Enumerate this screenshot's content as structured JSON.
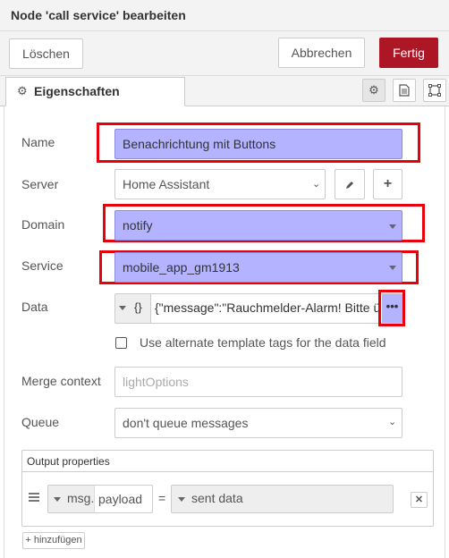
{
  "header": {
    "title": "Node 'call service' bearbeiten"
  },
  "toolbar": {
    "delete_label": "Löschen",
    "cancel_label": "Abbrechen",
    "done_label": "Fertig"
  },
  "tabs": {
    "properties_label": "Eigenschaften"
  },
  "form": {
    "name_label": "Name",
    "name_value": "Benachrichtung mit Buttons",
    "server_label": "Server",
    "server_value": "Home Assistant",
    "domain_label": "Domain",
    "domain_value": "notify",
    "service_label": "Service",
    "service_value": "mobile_app_gm1913",
    "data_label": "Data",
    "data_type": "{}",
    "data_value": "{\"message\":\"Rauchmelder-Alarm! Bitte üb",
    "alt_tags_label": "Use alternate template tags for the data field",
    "merge_label": "Merge context",
    "merge_placeholder": "lightOptions",
    "queue_label": "Queue",
    "queue_value": "don't queue messages"
  },
  "output": {
    "title": "Output properties",
    "prefix": "msg.",
    "property": "payload",
    "equals": "=",
    "value": "sent data",
    "add_label": "hinzufügen"
  },
  "colors": {
    "highlight": "#b3b3ff",
    "annotation": "#e8000b",
    "primary": "#ad1625"
  }
}
